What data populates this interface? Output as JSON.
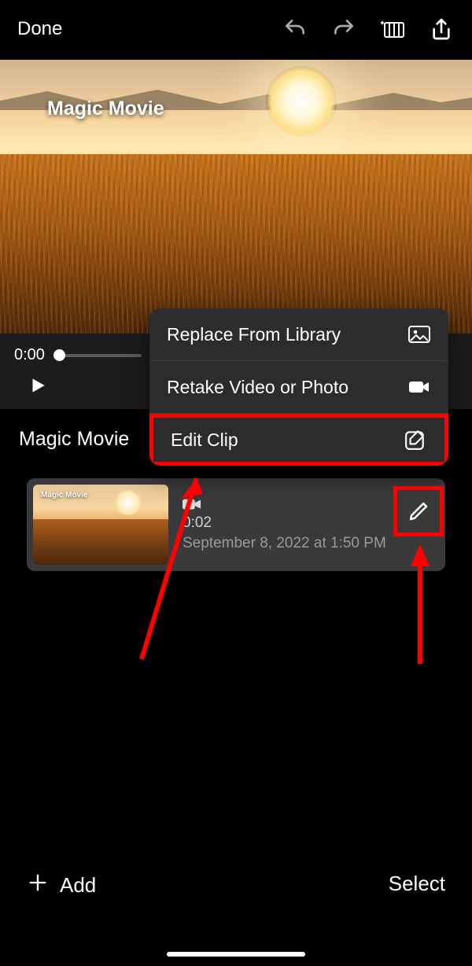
{
  "toolbar": {
    "done_label": "Done"
  },
  "preview": {
    "overlay_title": "Magic Movie"
  },
  "playback": {
    "current_time": "0:00"
  },
  "section": {
    "title": "Magic Movie"
  },
  "menu": {
    "replace_label": "Replace From Library",
    "retake_label": "Retake Video or Photo",
    "edit_label": "Edit Clip"
  },
  "clip": {
    "thumb_label": "Magic Movie",
    "duration": "0:02",
    "datetime": "September 8, 2022 at 1:50 PM"
  },
  "bottom": {
    "add_label": "Add",
    "select_label": "Select"
  }
}
